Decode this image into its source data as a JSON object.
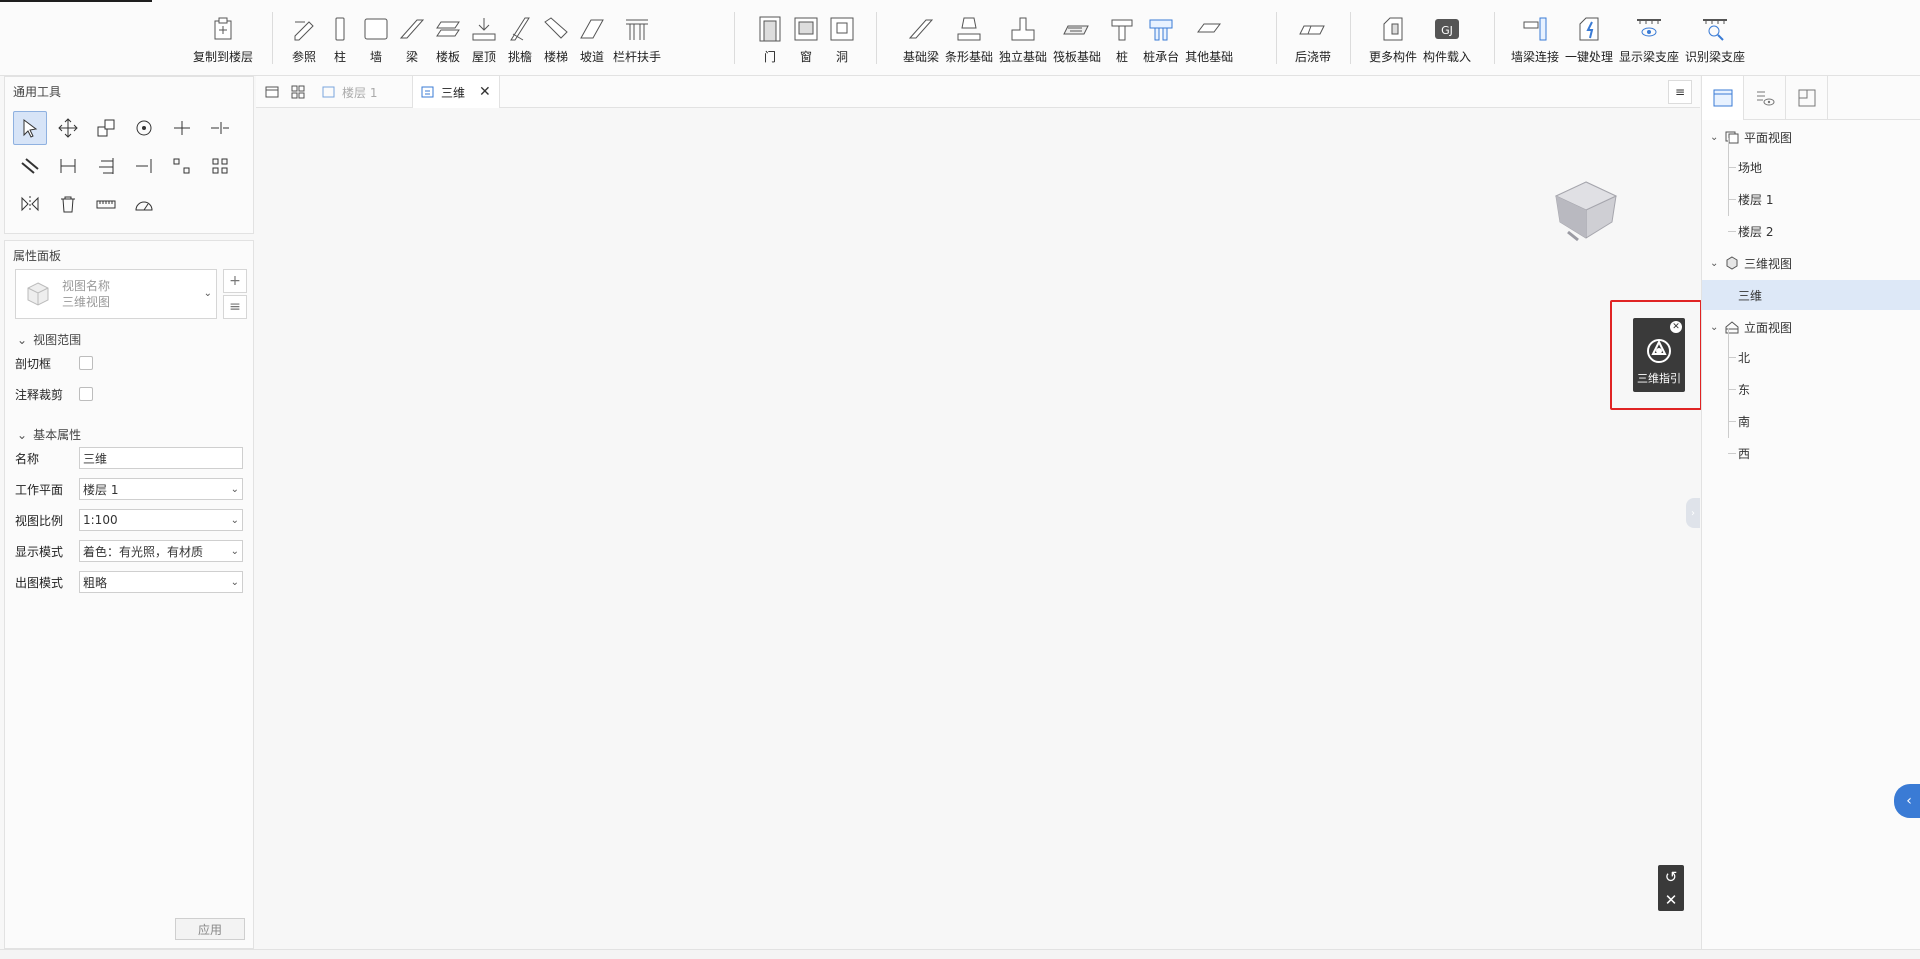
{
  "ribbon": {
    "groups": [
      {
        "items": [
          "复制到楼层"
        ]
      },
      {
        "items": [
          "参照",
          "柱",
          "墙",
          "梁",
          "楼板",
          "屋顶",
          "挑檐",
          "楼梯",
          "坡道",
          "栏杆扶手"
        ]
      },
      {
        "items": [
          "门",
          "窗",
          "洞"
        ]
      },
      {
        "items": [
          "基础梁",
          "条形基础",
          "独立基础",
          "筏板基础",
          "桩",
          "桩承台",
          "其他基础"
        ]
      },
      {
        "items": [
          "后浇带"
        ]
      },
      {
        "items": [
          "更多构件",
          "构件载入"
        ]
      },
      {
        "items": [
          "墙梁连接",
          "一键处理",
          "显示梁支座",
          "识别梁支座"
        ]
      }
    ]
  },
  "tools_panel": {
    "title": "通用工具",
    "tools": [
      "select-icon",
      "move-icon",
      "copy-icon",
      "rotate-icon",
      "trim-icon",
      "split-icon",
      "offset-icon",
      "dimension-icon",
      "align-icon",
      "extend-icon",
      "array-icon",
      "group-icon",
      "mirror-icon",
      "delete-icon",
      "measure-icon",
      "angle-icon"
    ]
  },
  "properties_panel": {
    "title": "属性面板",
    "view_name_placeholder": "视图名称",
    "view_type": "三维视图",
    "sections": {
      "view_range": "视图范围",
      "basic": "基本属性"
    },
    "view_range_rows": [
      "剖切框",
      "注释裁剪"
    ],
    "basic_rows": [
      {
        "label": "名称",
        "value": "三维"
      },
      {
        "label": "工作平面",
        "value": "楼层 1"
      },
      {
        "label": "视图比例",
        "value": "1:100"
      },
      {
        "label": "显示模式",
        "value": "着色：有光照，有材质"
      },
      {
        "label": "出图模式",
        "value": "粗略"
      }
    ],
    "apply_label": "应用"
  },
  "tabs": [
    {
      "label": "楼层 1",
      "active": false
    },
    {
      "label": "三维",
      "active": true
    }
  ],
  "viewport": {
    "guide_label": "三维指引"
  },
  "right_panel": {
    "tree": [
      {
        "label": "平面视图",
        "children": [
          "场地",
          "楼层 1",
          "楼层 2"
        ]
      },
      {
        "label": "三维视图",
        "children": [
          "三维"
        ]
      },
      {
        "label": "立面视图",
        "children": [
          "北",
          "东",
          "南",
          "西"
        ]
      }
    ],
    "selected": "三维"
  },
  "colors": {
    "accent": "#3a7bd5",
    "highlight_frame": "#e02424",
    "selection": "#dde8f7"
  }
}
